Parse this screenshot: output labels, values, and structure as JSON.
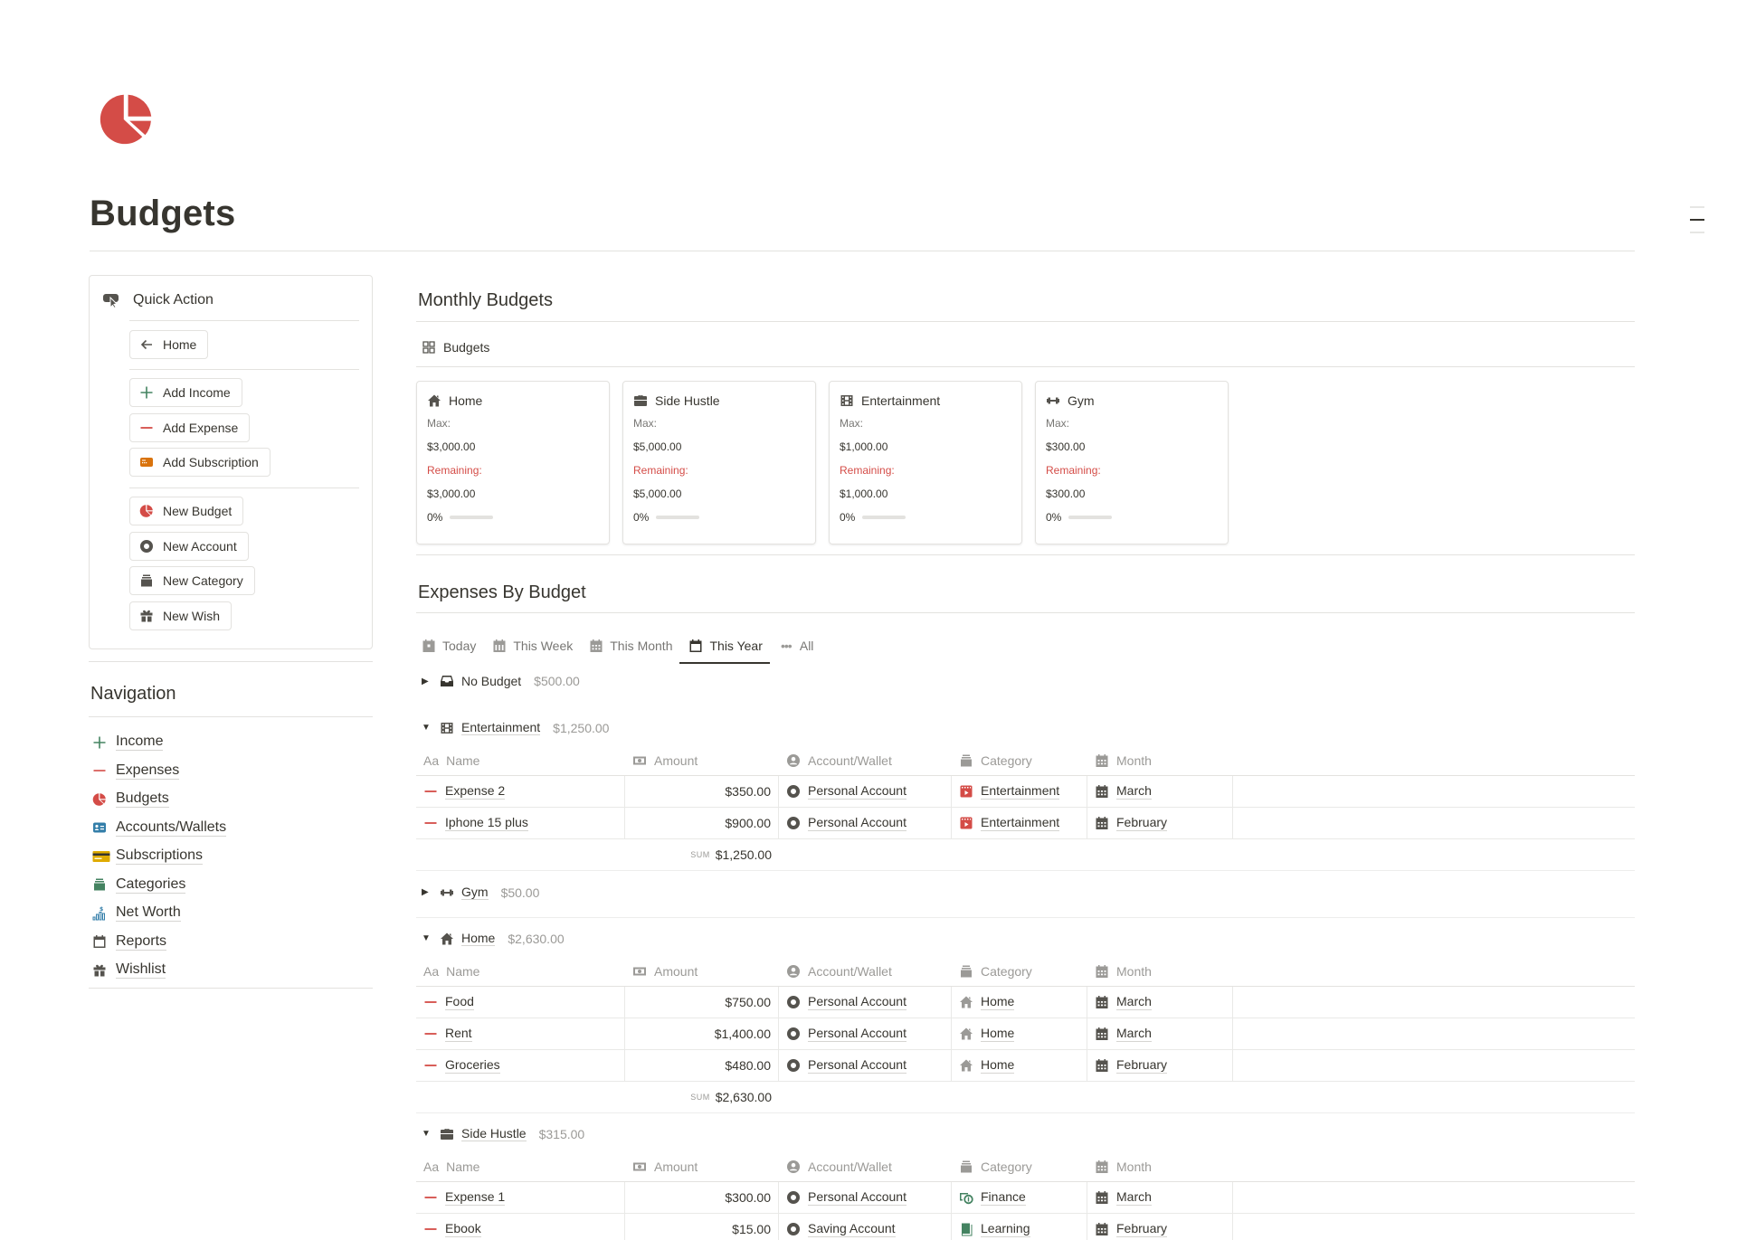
{
  "page": {
    "title": "Budgets",
    "icon": "pie-chart-icon",
    "accent_color": "#d44c47"
  },
  "quick_action": {
    "title": "Quick Action",
    "buttons": [
      {
        "label": "Home",
        "icon": "arrow-left-icon"
      },
      {
        "label": "Add Income",
        "icon": "plus-icon"
      },
      {
        "label": "Add Expense",
        "icon": "minus-icon"
      },
      {
        "label": "Add Subscription",
        "icon": "card-icon"
      },
      {
        "label": "New Budget",
        "icon": "pie-chart-icon"
      },
      {
        "label": "New Account",
        "icon": "ring-icon"
      },
      {
        "label": "New Category",
        "icon": "stack-icon"
      },
      {
        "label": "New Wish",
        "icon": "gift-icon"
      }
    ]
  },
  "navigation": {
    "title": "Navigation",
    "items": [
      {
        "label": "Income",
        "icon": "plus-icon"
      },
      {
        "label": "Expenses",
        "icon": "minus-icon"
      },
      {
        "label": "Budgets",
        "icon": "pie-chart-icon"
      },
      {
        "label": "Accounts/Wallets",
        "icon": "id-card-icon"
      },
      {
        "label": "Subscriptions",
        "icon": "credit-card-icon"
      },
      {
        "label": "Categories",
        "icon": "stack-icon"
      },
      {
        "label": "Net Worth",
        "icon": "bar-chart-dollar-icon"
      },
      {
        "label": "Reports",
        "icon": "calendar-icon"
      },
      {
        "label": "Wishlist",
        "icon": "gift-icon"
      }
    ]
  },
  "monthly_budgets": {
    "title": "Monthly Budgets",
    "view_label": "Budgets",
    "max_label": "Max:",
    "remaining_label": "Remaining:",
    "cards": [
      {
        "name": "Home",
        "icon": "house-icon",
        "max": "$3,000.00",
        "remaining": "$3,000.00",
        "progress_label": "0%",
        "progress": 0
      },
      {
        "name": "Side Hustle",
        "icon": "briefcase-icon",
        "max": "$5,000.00",
        "remaining": "$5,000.00",
        "progress_label": "0%",
        "progress": 0
      },
      {
        "name": "Entertainment",
        "icon": "film-icon",
        "max": "$1,000.00",
        "remaining": "$1,000.00",
        "progress_label": "0%",
        "progress": 0
      },
      {
        "name": "Gym",
        "icon": "dumbbell-icon",
        "max": "$300.00",
        "remaining": "$300.00",
        "progress_label": "0%",
        "progress": 0
      }
    ]
  },
  "expenses_by_budget": {
    "title": "Expenses By Budget",
    "tabs": [
      {
        "label": "Today",
        "icon": "calendar-day-icon",
        "active": false
      },
      {
        "label": "This Week",
        "icon": "calendar-week-icon",
        "active": false
      },
      {
        "label": "This Month",
        "icon": "calendar-month-icon",
        "active": false
      },
      {
        "label": "This Year",
        "icon": "calendar-icon",
        "active": true
      },
      {
        "label": "All",
        "icon": "ellipsis-icon",
        "active": false
      }
    ],
    "columns": [
      "Name",
      "Amount",
      "Account/Wallet",
      "Category",
      "Month"
    ],
    "column_prefix_name": "Aa",
    "sum_label": "SUM",
    "groups": [
      {
        "name": "No Budget",
        "icon": "inbox-icon",
        "total": "$500.00",
        "expanded": false,
        "rows": []
      },
      {
        "name": "Entertainment",
        "icon": "film-icon",
        "total": "$1,250.00",
        "expanded": true,
        "rows": [
          {
            "name": "Expense 2",
            "amount": "$350.00",
            "account": "Personal Account",
            "category": "Entertainment",
            "category_icon": "clapper-icon",
            "month": "March"
          },
          {
            "name": "Iphone 15 plus",
            "amount": "$900.00",
            "account": "Personal Account",
            "category": "Entertainment",
            "category_icon": "clapper-icon",
            "month": "February"
          }
        ],
        "sum": "$1,250.00"
      },
      {
        "name": "Gym",
        "icon": "dumbbell-icon",
        "total": "$50.00",
        "expanded": false,
        "rows": []
      },
      {
        "name": "Home",
        "icon": "house-icon",
        "total": "$2,630.00",
        "expanded": true,
        "rows": [
          {
            "name": "Food",
            "amount": "$750.00",
            "account": "Personal Account",
            "category": "Home",
            "category_icon": "house-icon",
            "month": "March"
          },
          {
            "name": "Rent",
            "amount": "$1,400.00",
            "account": "Personal Account",
            "category": "Home",
            "category_icon": "house-icon",
            "month": "March"
          },
          {
            "name": "Groceries",
            "amount": "$480.00",
            "account": "Personal Account",
            "category": "Home",
            "category_icon": "house-icon",
            "month": "February"
          }
        ],
        "sum": "$2,630.00"
      },
      {
        "name": "Side Hustle",
        "icon": "briefcase-icon",
        "total": "$315.00",
        "expanded": true,
        "rows": [
          {
            "name": "Expense 1",
            "amount": "$300.00",
            "account": "Personal Account",
            "category": "Finance",
            "category_icon": "money-cycle-icon",
            "month": "March"
          },
          {
            "name": "Ebook",
            "amount": "$15.00",
            "account": "Saving Account",
            "category": "Learning",
            "category_icon": "book-icon",
            "month": "February"
          }
        ]
      }
    ]
  }
}
